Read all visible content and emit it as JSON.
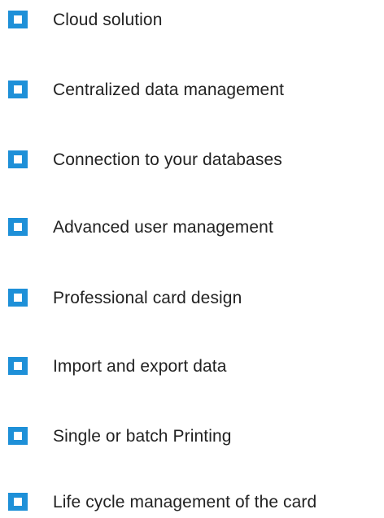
{
  "colors": {
    "bullet": "#1e90d8",
    "bullet_inner": "#ffffff",
    "text": "#222222",
    "background": "#ffffff"
  },
  "features": [
    {
      "icon": "square-bullet-icon",
      "label": "Cloud solution"
    },
    {
      "icon": "square-bullet-icon",
      "label": "Centralized data management"
    },
    {
      "icon": "square-bullet-icon",
      "label": "Connection to your databases"
    },
    {
      "icon": "square-bullet-icon",
      "label": "Advanced user management"
    },
    {
      "icon": "square-bullet-icon",
      "label": "Professional card design"
    },
    {
      "icon": "square-bullet-icon",
      "label": "Import and export data"
    },
    {
      "icon": "square-bullet-icon",
      "label": "Single or batch Printing"
    },
    {
      "icon": "square-bullet-icon",
      "label": "Life cycle management of the card"
    }
  ]
}
